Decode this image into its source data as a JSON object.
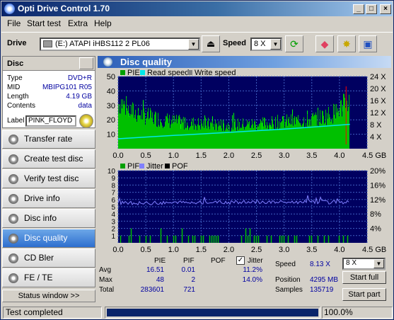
{
  "window": {
    "title": "Opti Drive Control 1.70"
  },
  "menu": [
    "File",
    "Start test",
    "Extra",
    "Help"
  ],
  "toolbar": {
    "drive_label": "Drive",
    "drive_value": "(E:)   ATAPI iHBS112   2 PL06",
    "speed_label": "Speed",
    "speed_value": "8 X"
  },
  "disc": {
    "header": "Disc",
    "rows": [
      {
        "key": "Type",
        "value": "DVD+R"
      },
      {
        "key": "MID",
        "value": "MBIPG101 R05"
      },
      {
        "key": "Length",
        "value": "4.19 GB"
      },
      {
        "key": "Contents",
        "value": "data"
      }
    ],
    "label_key": "Label",
    "label_value": "PINK_FLOYD"
  },
  "nav": [
    {
      "label": "Transfer rate",
      "active": false
    },
    {
      "label": "Create test disc",
      "active": false
    },
    {
      "label": "Verify test disc",
      "active": false
    },
    {
      "label": "Drive info",
      "active": false
    },
    {
      "label": "Disc info",
      "active": false
    },
    {
      "label": "Disc quality",
      "active": true
    },
    {
      "label": "CD Bler",
      "active": false
    },
    {
      "label": "FE / TE",
      "active": false
    }
  ],
  "status_window": "Status window >>",
  "panel_title": "Disc quality",
  "chart_data": [
    {
      "type": "area",
      "legend": [
        "PIE",
        "Read speed",
        "Write speed"
      ],
      "legend_colors": [
        "#00a000",
        "#00e8e8",
        "#808080"
      ],
      "x_ticks": [
        "0.0",
        "0.5",
        "1.0",
        "1.5",
        "2.0",
        "2.5",
        "3.0",
        "3.5",
        "4.0",
        "4.5 GB"
      ],
      "xlim": [
        0,
        4.5
      ],
      "y_left_ticks": [
        "50",
        "40",
        "30",
        "20",
        "10"
      ],
      "ylim_left": [
        0,
        50
      ],
      "y_right_ticks": [
        "24 X",
        "20 X",
        "16 X",
        "12 X",
        "8 X",
        "4 X"
      ],
      "ylim_right": [
        0,
        24
      ],
      "pie_envelope": {
        "x": [
          0.0,
          0.05,
          0.15,
          0.3,
          0.6,
          1.0,
          1.5,
          2.0,
          2.5,
          3.0,
          3.3,
          3.6,
          3.9,
          4.1,
          4.19
        ],
        "y": [
          40,
          42,
          36,
          32,
          28,
          24,
          22,
          21,
          22,
          24,
          25,
          27,
          32,
          40,
          44
        ]
      },
      "read_speed": {
        "x": [
          0.0,
          1.0,
          2.0,
          3.0,
          4.19
        ],
        "y": [
          3.3,
          4.4,
          5.4,
          6.5,
          8.1
        ]
      },
      "colors": {
        "pie": "#00c000",
        "pie_peak": "#00ff00",
        "read": "#00e8e8",
        "bg": "#000060",
        "grid": "#4060c0",
        "red_marker": "#ff0000"
      }
    },
    {
      "type": "bar",
      "legend": [
        "PIF",
        "Jitter",
        "POF"
      ],
      "legend_colors": [
        "#00a000",
        "#8080ff",
        "#000000"
      ],
      "x_ticks": [
        "0.0",
        "0.5",
        "1.0",
        "1.5",
        "2.0",
        "2.5",
        "3.0",
        "3.5",
        "4.0",
        "4.5 GB"
      ],
      "xlim": [
        0,
        4.5
      ],
      "y_left_ticks": [
        "10",
        "9",
        "8",
        "7",
        "6",
        "5",
        "4",
        "3",
        "2",
        "1"
      ],
      "ylim_left": [
        0,
        10
      ],
      "y_right_ticks": [
        "20%",
        "16%",
        "12%",
        "8%",
        "4%"
      ],
      "ylim_right": [
        0,
        20
      ],
      "jitter": {
        "x": [
          0.0,
          0.5,
          1.0,
          1.5,
          2.0,
          2.5,
          3.0,
          3.5,
          4.0,
          4.19
        ],
        "y": [
          11.0,
          11.0,
          11.1,
          11.2,
          11.2,
          11.3,
          11.3,
          11.3,
          11.2,
          11.3
        ]
      },
      "pif_max": 2
    }
  ],
  "stats": {
    "headers": [
      "PIE",
      "PIF",
      "POF",
      "Jitter"
    ],
    "jitter_checked": true,
    "rows": [
      {
        "label": "Avg",
        "pie": "16.51",
        "pif": "0.01",
        "pof": "",
        "jitter": "11.2%"
      },
      {
        "label": "Max",
        "pie": "48",
        "pif": "2",
        "pof": "",
        "jitter": "14.0%"
      },
      {
        "label": "Total",
        "pie": "283601",
        "pif": "721",
        "pof": "",
        "jitter": ""
      }
    ],
    "speed_label": "Speed",
    "speed_value": "8.13 X",
    "position_label": "Position",
    "position_value": "4295 MB",
    "samples_label": "Samples",
    "samples_value": "135719",
    "speed_combo": "8 X",
    "start_full": "Start full",
    "start_part": "Start part"
  },
  "statusbar": {
    "text": "Test completed",
    "progress": 1.0,
    "percent": "100.0%"
  }
}
